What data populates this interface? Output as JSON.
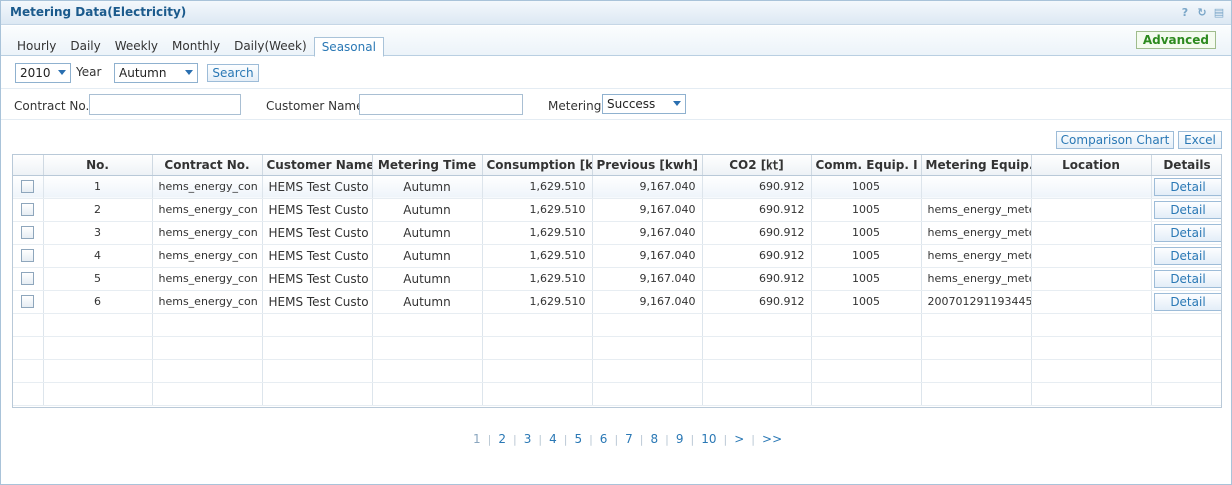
{
  "window": {
    "title": "Metering Data(Electricity)",
    "icons": [
      "help-icon",
      "refresh-icon",
      "maximize-icon"
    ]
  },
  "tabs": [
    {
      "label": "Hourly"
    },
    {
      "label": "Daily"
    },
    {
      "label": "Weekly"
    },
    {
      "label": "Monthly"
    },
    {
      "label": "Daily(Week)"
    },
    {
      "label": "Seasonal",
      "active": true
    }
  ],
  "advanced_label": "Advanced",
  "filters": {
    "year_value": "2010",
    "year_label": "Year",
    "season_value": "Autumn",
    "search_label": "Search",
    "contract_label": "Contract No.",
    "contract_value": "",
    "customer_label": "Customer Name",
    "customer_value": "",
    "metering_label": "Metering",
    "metering_value": "Success"
  },
  "actions": {
    "comparison_chart": "Comparison  Chart",
    "excel": "Excel"
  },
  "table": {
    "headers": [
      "No.",
      "Contract No.",
      "Customer Name",
      "Metering Time",
      "Consumption [k",
      "Previous [kwh]",
      "CO2 [㏏]",
      "Comm. Equip. I",
      "Metering Equip.",
      "Location",
      "Details"
    ],
    "detail_label": "Detail",
    "rows": [
      {
        "no": "1",
        "contract": "hems_energy_con",
        "customer": "HEMS Test Custo",
        "time": "Autumn",
        "consumption": "1,629.510",
        "previous": "9,167.040",
        "co2": "690.912",
        "comm": "1005",
        "metering": "",
        "location": ""
      },
      {
        "no": "2",
        "contract": "hems_energy_con",
        "customer": "HEMS Test Custo",
        "time": "Autumn",
        "consumption": "1,629.510",
        "previous": "9,167.040",
        "co2": "690.912",
        "comm": "1005",
        "metering": "hems_energy_mete",
        "location": ""
      },
      {
        "no": "3",
        "contract": "hems_energy_con",
        "customer": "HEMS Test Custo",
        "time": "Autumn",
        "consumption": "1,629.510",
        "previous": "9,167.040",
        "co2": "690.912",
        "comm": "1005",
        "metering": "hems_energy_mete",
        "location": ""
      },
      {
        "no": "4",
        "contract": "hems_energy_con",
        "customer": "HEMS Test Custo",
        "time": "Autumn",
        "consumption": "1,629.510",
        "previous": "9,167.040",
        "co2": "690.912",
        "comm": "1005",
        "metering": "hems_energy_mete",
        "location": ""
      },
      {
        "no": "5",
        "contract": "hems_energy_con",
        "customer": "HEMS Test Custo",
        "time": "Autumn",
        "consumption": "1,629.510",
        "previous": "9,167.040",
        "co2": "690.912",
        "comm": "1005",
        "metering": "hems_energy_mete",
        "location": ""
      },
      {
        "no": "6",
        "contract": "hems_energy_con",
        "customer": "HEMS Test Custo",
        "time": "Autumn",
        "consumption": "1,629.510",
        "previous": "9,167.040",
        "co2": "690.912",
        "comm": "1005",
        "metering": "200701291193445",
        "location": ""
      }
    ],
    "empty_rows": 4
  },
  "pagination": {
    "pages": [
      "1",
      "2",
      "3",
      "4",
      "5",
      "6",
      "7",
      "8",
      "9",
      "10"
    ],
    "current": "1",
    "next": ">",
    "last": ">>"
  }
}
